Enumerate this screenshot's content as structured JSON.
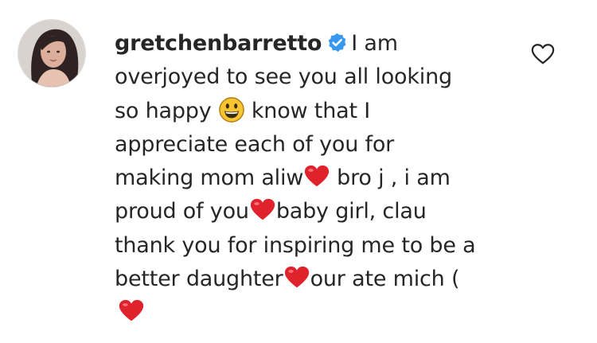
{
  "comment": {
    "username": "gretchenbarretto",
    "lines": [
      "I am",
      "overjoyed to see you all looking",
      "so happy",
      "know that I",
      "appreciate each of you for",
      "making mom aliw",
      "bro j , i am",
      "proud of you",
      "baby girl, clau",
      "thank you for inspiring me to be a",
      "better daughter",
      "our ate mich ("
    ],
    "colors": {
      "text": "#262626",
      "verified": "#3897f0",
      "heart": "#e0222c"
    },
    "icons": [
      "verified-badge-icon",
      "grinning-face-emoji-icon",
      "red-heart-emoji-icon",
      "like-heart-icon"
    ]
  }
}
